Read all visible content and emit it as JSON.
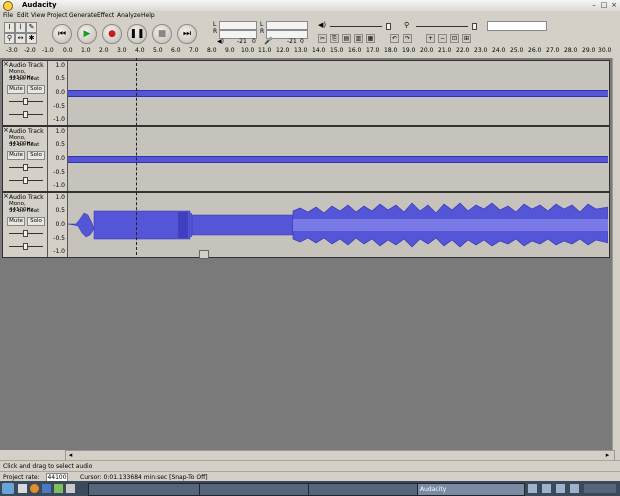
{
  "window": {
    "title": "Audacity"
  },
  "menu": [
    "File",
    "Edit",
    "View",
    "Project",
    "Generate",
    "Effect",
    "Analyze",
    "Help"
  ],
  "meters": {
    "left_label": "L",
    "right_label": "R",
    "db_marks": [
      "-21",
      "0"
    ],
    "db_marks2": [
      "-21",
      "0"
    ]
  },
  "ruler": {
    "ticks": [
      "-3.0",
      "-2.0",
      "-1.0",
      "0.0",
      "1.0",
      "2.0",
      "3.0",
      "4.0",
      "5.0",
      "6.0",
      "7.0",
      "8.0",
      "9.0",
      "10.0",
      "11.0",
      "12.0",
      "13.0",
      "14.0",
      "15.0",
      "16.0",
      "17.0",
      "18.0",
      "19.0",
      "20.0",
      "21.0",
      "22.0",
      "23.0",
      "24.0",
      "25.0",
      "26.0",
      "27.0",
      "28.0",
      "29.0",
      "30.0"
    ]
  },
  "tracks": [
    {
      "name": "Audio Track",
      "info1": "Mono, 44100Hz",
      "info2": "32-bit float",
      "mute": "Mute",
      "solo": "Solo",
      "scale": [
        "1.0",
        "0.5",
        "0.0",
        "-0.5",
        "-1.0"
      ]
    },
    {
      "name": "Audio Track",
      "info1": "Mono, 44100Hz",
      "info2": "32-bit float",
      "mute": "Mute",
      "solo": "Solo",
      "scale": [
        "1.0",
        "0.5",
        "0.0",
        "-0.5",
        "-1.0"
      ]
    },
    {
      "name": "Audio Track",
      "info1": "Mono, 44100Hz",
      "info2": "32-bit float",
      "mute": "Mute",
      "solo": "Solo",
      "scale": [
        "1.0",
        "0.5",
        "0.0",
        "-0.5",
        "-1.0"
      ]
    }
  ],
  "status": {
    "hint": "Click and drag to select audio",
    "project_rate_label": "Project rate:",
    "project_rate": "44100",
    "cursor": "Cursor: 0:01.133684 min:sec  [Snap-To Off]"
  },
  "taskbar": {
    "active": "Audacity"
  },
  "colors": {
    "wave": "#5555d8",
    "wave_dark": "#3333a8",
    "track_bg": "#c6c3bc"
  }
}
